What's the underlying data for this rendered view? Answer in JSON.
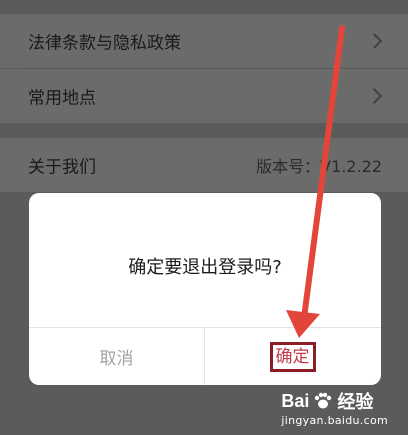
{
  "settings": {
    "items": [
      {
        "label": "法律条款与隐私政策"
      },
      {
        "label": "常用地点"
      },
      {
        "label": "关于我们",
        "value": "版本号：V1.2.22"
      }
    ]
  },
  "dialog": {
    "message": "确定要退出登录吗?",
    "cancel_label": "取消",
    "confirm_label": "确定"
  },
  "annotation": {
    "arrow_color": "#e3453a"
  },
  "watermark": {
    "brand": "Bai",
    "brand_tail": "经验",
    "url": "jingyan.baidu.com"
  }
}
